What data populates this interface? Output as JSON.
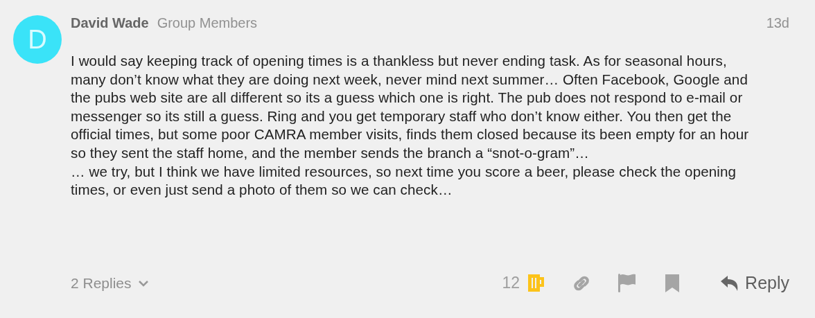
{
  "post": {
    "avatar_letter": "D",
    "author": "David Wade",
    "group": "Group Members",
    "time": "13d",
    "paragraphs": [
      "I would say keeping track of opening times is a thankless but never ending task. As for seasonal hours, many don’t know what they are doing next week, never mind next summer… Often Facebook, Google and the pubs web site are all different so its a guess which one is right. The pub does not respond to e-mail or messenger so its still a guess. Ring and you get temporary staff who don’t know either. You then get the official times, but some poor CAMRA member visits, finds them closed because its been empty for an hour so they sent the staff home, and the member sends the branch a “snot-o-gram”…",
      "… we try, but I think we have limited resources, so next time you score a beer, please check the opening times, or even just send a photo of them so we can check…"
    ]
  },
  "footer": {
    "replies": "2 Replies",
    "likes": "12",
    "reply": "Reply"
  }
}
